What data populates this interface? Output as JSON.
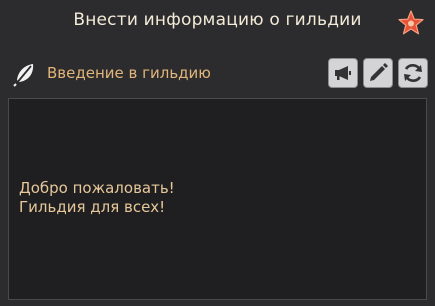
{
  "window": {
    "title": "Внести информацию о гильдии",
    "star_icon": "star-icon",
    "star_color": "#e8543a"
  },
  "section": {
    "label": "Введение в гильдию",
    "icon": "feather-icon",
    "label_color": "#e2b57a"
  },
  "toolbar": {
    "announce_icon": "megaphone-icon",
    "edit_icon": "pencil-icon",
    "refresh_icon": "refresh-icon"
  },
  "content": {
    "lines": [
      "Добро пожаловать!",
      "Гильдия для всех!"
    ],
    "text_color": "#e6c79a"
  }
}
